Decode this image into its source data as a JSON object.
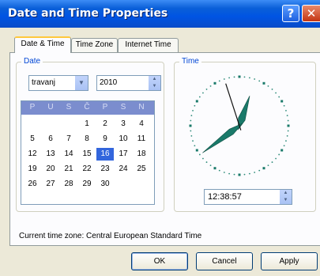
{
  "window": {
    "title": "Date and Time Properties"
  },
  "titlebar": {
    "help_glyph": "?",
    "close_glyph": "✕"
  },
  "tabs": [
    {
      "label": "Date & Time",
      "active": true
    },
    {
      "label": "Time Zone",
      "active": false
    },
    {
      "label": "Internet Time",
      "active": false
    }
  ],
  "date_group": {
    "label": "Date",
    "month_value": "travanj",
    "year_value": "2010",
    "weekday_headers": [
      "P",
      "U",
      "S",
      "Č",
      "P",
      "S",
      "N"
    ],
    "weeks": [
      [
        "",
        "",
        "",
        "1",
        "2",
        "3",
        "4"
      ],
      [
        "5",
        "6",
        "7",
        "8",
        "9",
        "10",
        "11"
      ],
      [
        "12",
        "13",
        "14",
        "15",
        "16",
        "17",
        "18"
      ],
      [
        "19",
        "20",
        "21",
        "22",
        "23",
        "24",
        "25"
      ],
      [
        "26",
        "27",
        "28",
        "29",
        "30",
        "",
        ""
      ]
    ],
    "selected_day": "16"
  },
  "time_group": {
    "label": "Time",
    "time_value": "12:38:57",
    "clock": {
      "hours": 12,
      "minutes": 38,
      "seconds": 57
    }
  },
  "timezone_text": "Current time zone:  Central European Standard Time",
  "buttons": {
    "ok": "OK",
    "cancel": "Cancel",
    "apply": "Apply"
  },
  "colors": {
    "title_bar": "#0054e3",
    "calendar_header": "#7b8dce",
    "selection": "#3366dd",
    "hand": "#1a7a6a"
  }
}
